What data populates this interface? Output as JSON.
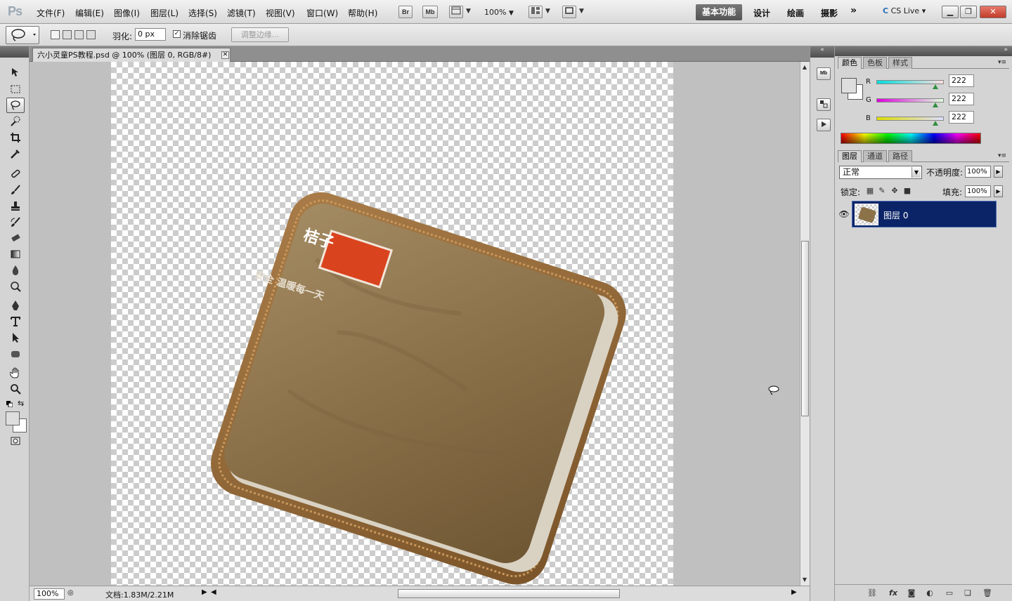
{
  "app": {
    "logo": "Ps"
  },
  "menu": [
    "文件(F)",
    "编辑(E)",
    "图像(I)",
    "图层(L)",
    "选择(S)",
    "滤镜(T)",
    "视图(V)",
    "窗口(W)",
    "帮助(H)"
  ],
  "menubar": {
    "bridge_label": "Br",
    "minibridge_label": "Mb",
    "zoom": "100%",
    "workspaces": [
      "基本功能",
      "设计",
      "绘画",
      "摄影"
    ],
    "more": "»",
    "cs_live": "CS Live ▾"
  },
  "options": {
    "feather_label": "羽化:",
    "feather_value": "0 px",
    "antialias_checked": "✓",
    "antialias_label": "消除锯齿",
    "refine_edge": "调整边缘..."
  },
  "document": {
    "tab_title": "六小灵童PS教程.psd @ 100% (图层 0, RGB/8#)",
    "close_glyph": "✕",
    "zoom": "100%",
    "doc_size": "文档:1.83M/2.21M",
    "product_brand": "桔子",
    "product_slogan": "安全 温暖每一天"
  },
  "color_panel": {
    "tabs": [
      "颜色",
      "色板",
      "样式"
    ],
    "channels": [
      {
        "label": "R",
        "value": "222"
      },
      {
        "label": "G",
        "value": "222"
      },
      {
        "label": "B",
        "value": "222"
      }
    ]
  },
  "layers_panel": {
    "tabs": [
      "图层",
      "通道",
      "路径"
    ],
    "blend_mode": "正常",
    "opacity_label": "不透明度:",
    "opacity": "100%",
    "lock_label": "锁定:",
    "fill_label": "填充:",
    "fill": "100%",
    "layers": [
      {
        "name": "图层 0",
        "visible": true,
        "selected": true
      }
    ]
  },
  "colors": {
    "foreground": "#dedede",
    "background": "#ffffff",
    "layer_selected": "#0a2467",
    "warmer_body": "#8c7249",
    "brand_label": "#d9441e"
  }
}
